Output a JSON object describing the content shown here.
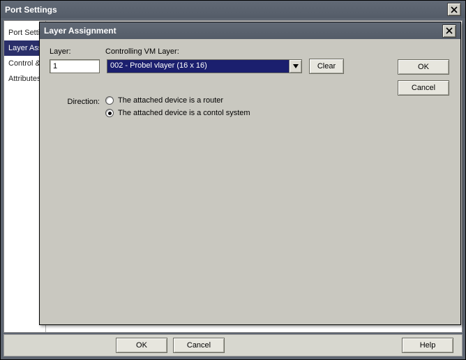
{
  "outer": {
    "title": "Port Settings",
    "tabs": [
      {
        "label": "Port Settings"
      },
      {
        "label": "Layer Assignment"
      },
      {
        "label": "Control & Status"
      },
      {
        "label": "Attributes"
      }
    ],
    "buttons": {
      "ok": "OK",
      "cancel": "Cancel",
      "help": "Help"
    }
  },
  "inner": {
    "title": "Layer Assignment",
    "labels": {
      "layer": "Layer:",
      "controlling_vm_layer": "Controlling VM Layer:",
      "direction": "Direction:"
    },
    "layer_value": "1",
    "controlling_vm_layer_value": "002 - Probel vlayer (16 x 16)",
    "buttons": {
      "clear": "Clear",
      "ok": "OK",
      "cancel": "Cancel"
    },
    "direction_options": [
      {
        "label": "The attached device is a router",
        "checked": false
      },
      {
        "label": "The attached device is a contol system",
        "checked": true
      }
    ]
  }
}
